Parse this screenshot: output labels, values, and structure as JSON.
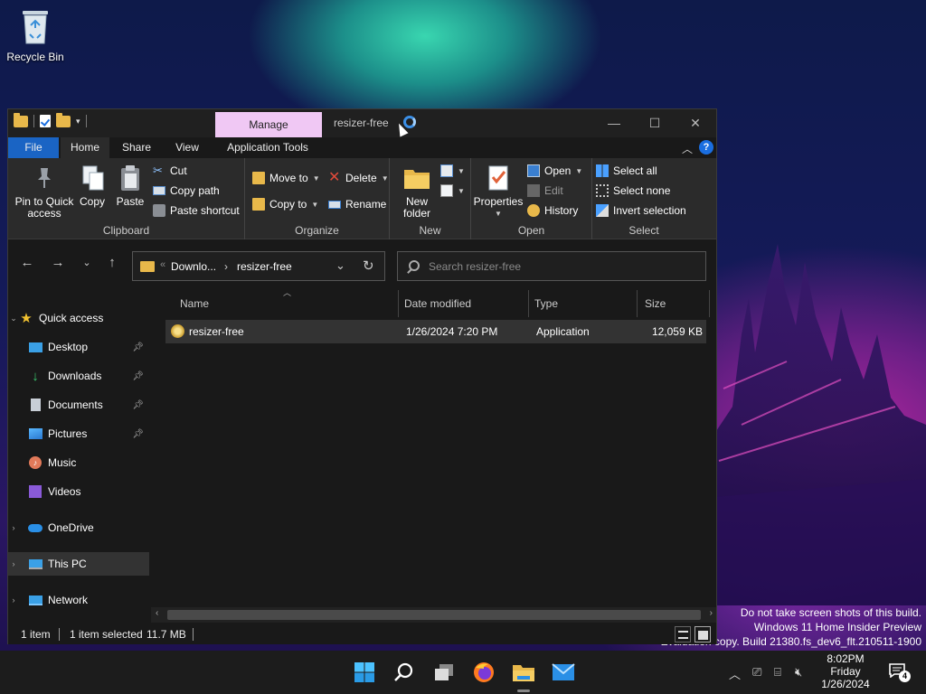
{
  "desktop": {
    "recycle_bin_label": "Recycle Bin",
    "watermark": [
      "Do not take screen shots of this build.",
      "Windows 11 Home Insider Preview",
      "Evaluation copy. Build 21380.fs_dev6_flt.210511-1900"
    ]
  },
  "window": {
    "title": "resizer-free",
    "context_tab": "Manage",
    "controls": {
      "minimize": "—",
      "maximize": "☐",
      "close": "✕"
    }
  },
  "ribbon_tabs": [
    "File",
    "Home",
    "Share",
    "View",
    "Application Tools"
  ],
  "ribbon": {
    "clipboard": {
      "name": "Clipboard",
      "pin": "Pin to Quick access",
      "copy": "Copy",
      "paste": "Paste",
      "cut": "Cut",
      "copy_path": "Copy path",
      "paste_shortcut": "Paste shortcut"
    },
    "organize": {
      "name": "Organize",
      "move_to": "Move to",
      "copy_to": "Copy to",
      "delete": "Delete",
      "rename": "Rename"
    },
    "new": {
      "name": "New",
      "new_folder": "New folder"
    },
    "open": {
      "name": "Open",
      "properties": "Properties",
      "open": "Open",
      "edit": "Edit",
      "history": "History"
    },
    "select": {
      "name": "Select",
      "select_all": "Select all",
      "select_none": "Select none",
      "invert": "Invert selection"
    }
  },
  "address": {
    "prefix": "«",
    "segment1": "Downlo...",
    "separator": "›",
    "segment2": "resizer-free"
  },
  "search": {
    "placeholder": "Search resizer-free"
  },
  "nav": {
    "quick_access": "Quick access",
    "items": [
      {
        "label": "Desktop",
        "pinned": true
      },
      {
        "label": "Downloads",
        "pinned": true
      },
      {
        "label": "Documents",
        "pinned": true
      },
      {
        "label": "Pictures",
        "pinned": true
      },
      {
        "label": "Music",
        "pinned": false
      },
      {
        "label": "Videos",
        "pinned": false
      }
    ],
    "onedrive": "OneDrive",
    "this_pc": "This PC",
    "network": "Network"
  },
  "columns": [
    "Name",
    "Date modified",
    "Type",
    "Size"
  ],
  "files": [
    {
      "name": "resizer-free",
      "date": "1/26/2024 7:20 PM",
      "type": "Application",
      "size": "12,059 KB"
    }
  ],
  "status": {
    "count": "1 item",
    "selected": "1 item selected",
    "size": "11.7 MB"
  },
  "taskbar": {
    "time": "8:02PM",
    "day": "Friday",
    "date": "1/26/2024",
    "notifications": "4"
  },
  "colors": {
    "accent": "#1a64c4",
    "context_tab": "#f0c8f4",
    "folder": "#e8b84a"
  }
}
